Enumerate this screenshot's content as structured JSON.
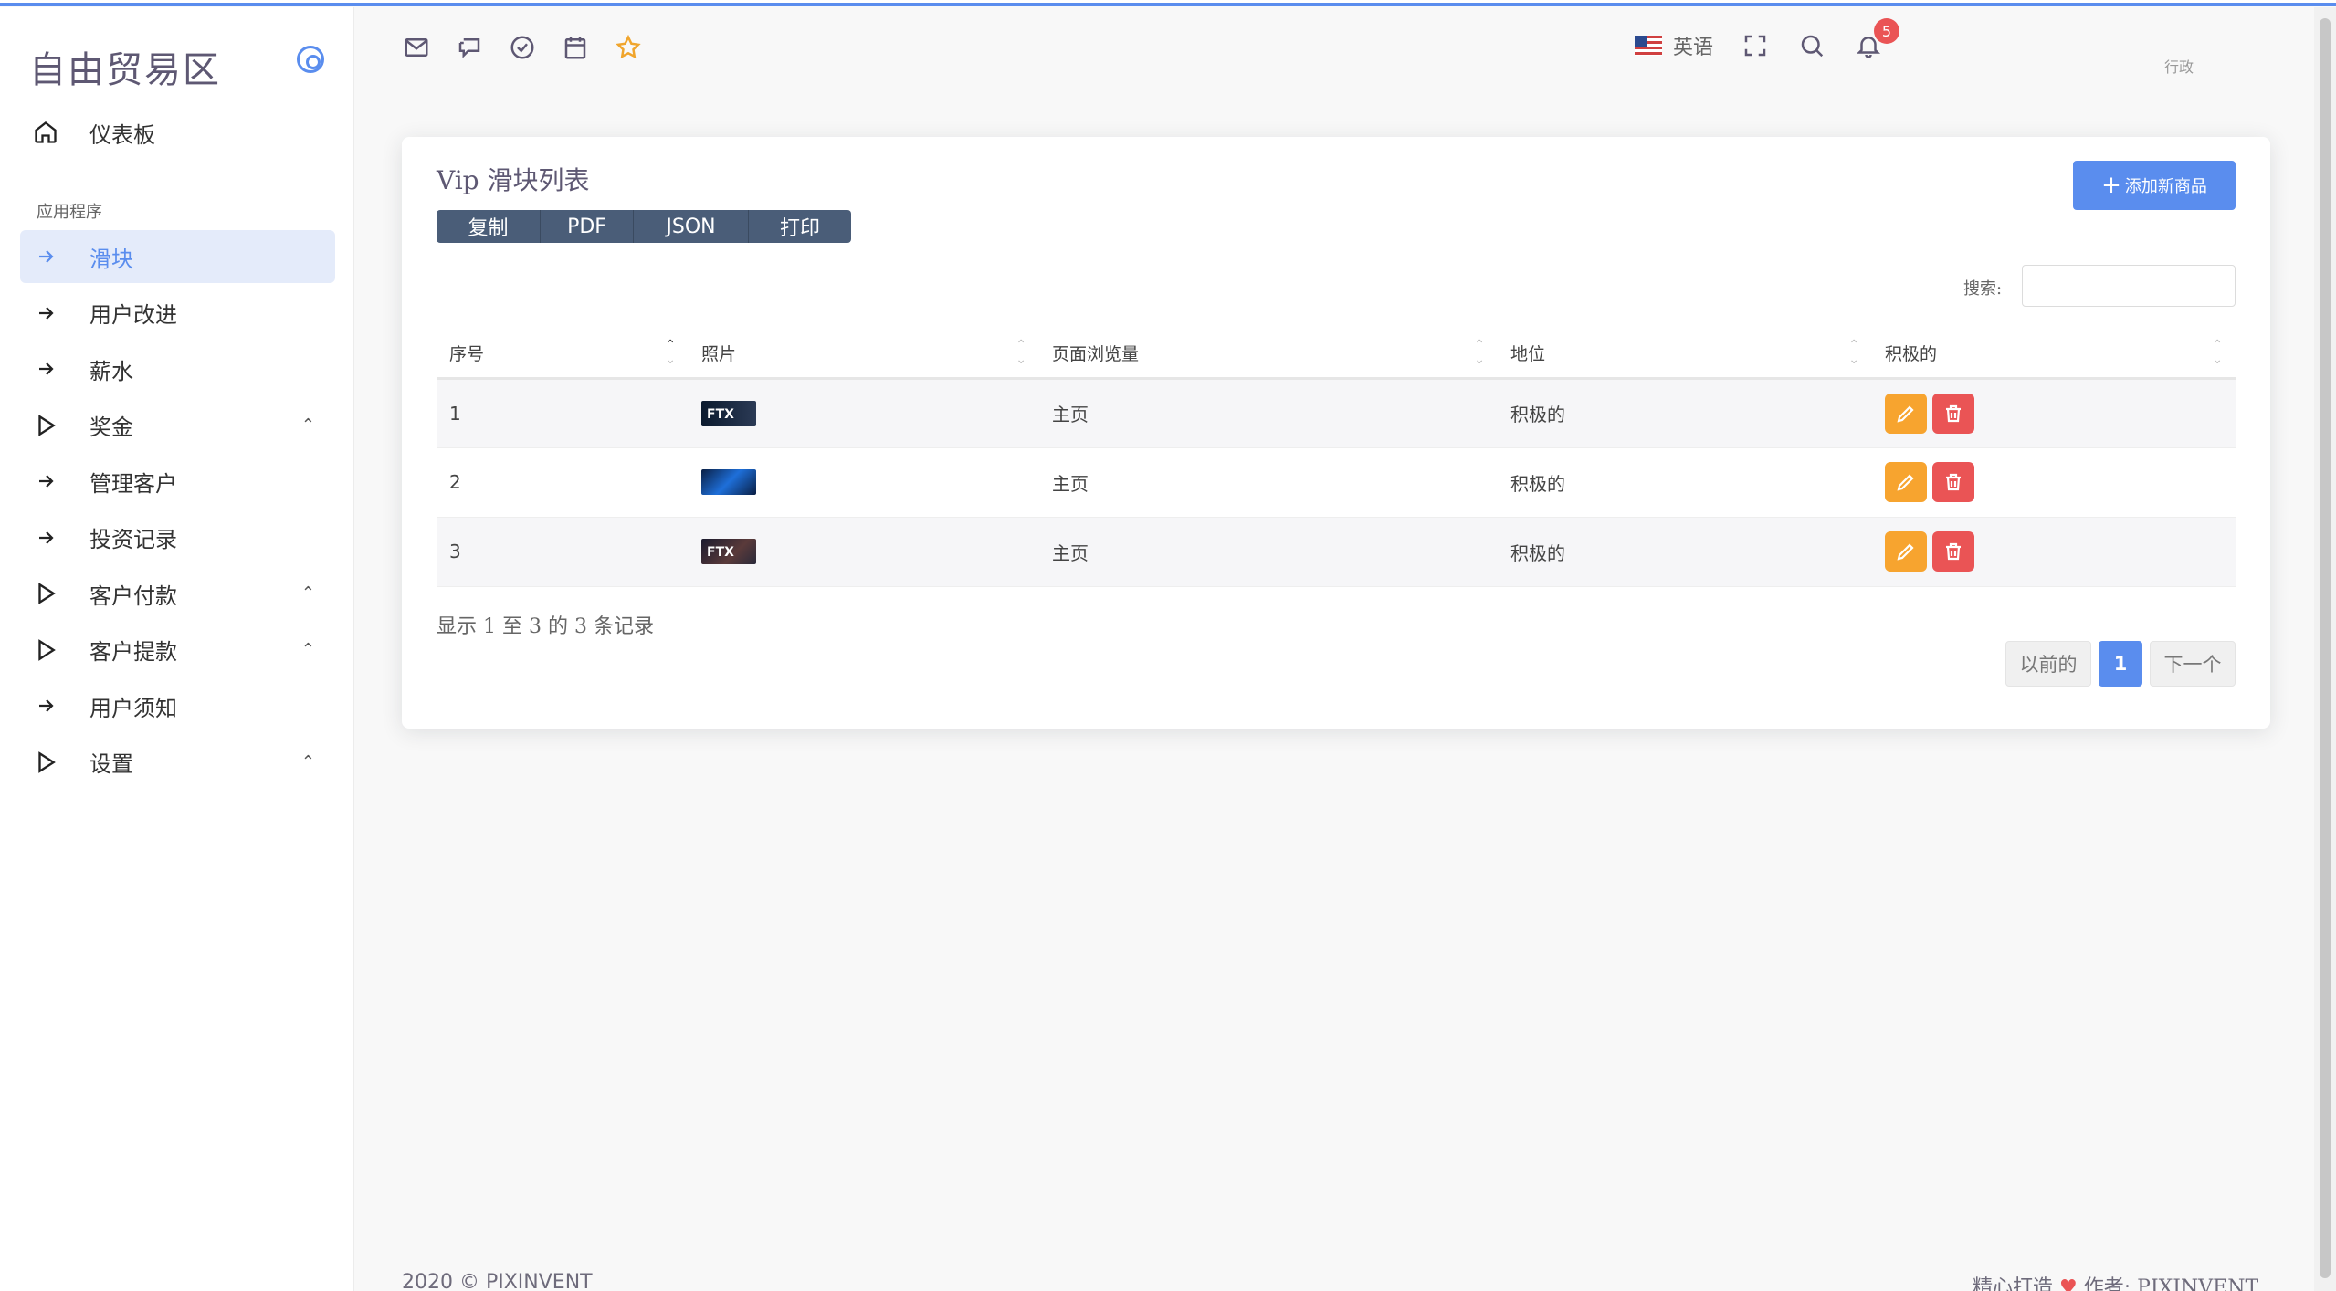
{
  "brand": "自由贸易区",
  "sidebar": {
    "dashboard": "仪表板",
    "section": "应用程序",
    "items": [
      {
        "label": "滑块",
        "icon": "arrow-right-icon",
        "active": true,
        "expandable": false
      },
      {
        "label": "用户改进",
        "icon": "arrow-right-icon",
        "expandable": false
      },
      {
        "label": "薪水",
        "icon": "arrow-right-icon",
        "expandable": false
      },
      {
        "label": "奖金",
        "icon": "triangle-right-icon",
        "expandable": true
      },
      {
        "label": "管理客户",
        "icon": "arrow-right-icon",
        "expandable": false
      },
      {
        "label": "投资记录",
        "icon": "arrow-right-icon",
        "expandable": false
      },
      {
        "label": "客户付款",
        "icon": "triangle-right-icon",
        "expandable": true
      },
      {
        "label": "客户提款",
        "icon": "triangle-right-icon",
        "expandable": true
      },
      {
        "label": "用户须知",
        "icon": "arrow-right-icon",
        "expandable": false
      },
      {
        "label": "设置",
        "icon": "triangle-right-icon",
        "expandable": true
      }
    ]
  },
  "header": {
    "icons": [
      "mail-icon",
      "chat-icon",
      "check-circle-icon",
      "calendar-icon",
      "star-icon"
    ],
    "language": "英语",
    "notification_count": "5",
    "user_role": "行政"
  },
  "card": {
    "title": "Vip 滑块列表",
    "export_buttons": [
      "复制",
      "PDF",
      "JSON",
      "打印"
    ],
    "add_button": "添加新商品",
    "search_label": "搜索:",
    "search_value": "",
    "columns": [
      "序号",
      "照片",
      "页面浏览量",
      "地位",
      "积极的"
    ],
    "rows": [
      {
        "id": "1",
        "photo_text": "FTX",
        "page": "主页",
        "status": "积极的"
      },
      {
        "id": "2",
        "photo_text": "",
        "page": "主页",
        "status": "积极的"
      },
      {
        "id": "3",
        "photo_text": "FTX",
        "page": "主页",
        "status": "积极的"
      }
    ],
    "info": "显示 1 至 3 的 3 条记录",
    "pagination": {
      "prev": "以前的",
      "current": "1",
      "next": "下一个"
    }
  },
  "footer": {
    "left": "2020 © PIXINVENT",
    "right_prefix": "精心打造",
    "right_suffix": "作者: PIXINVENT"
  },
  "colors": {
    "accent": "#5a8dee",
    "edit": "#f7a42f",
    "delete": "#ea5455",
    "export": "#4a5d78"
  }
}
